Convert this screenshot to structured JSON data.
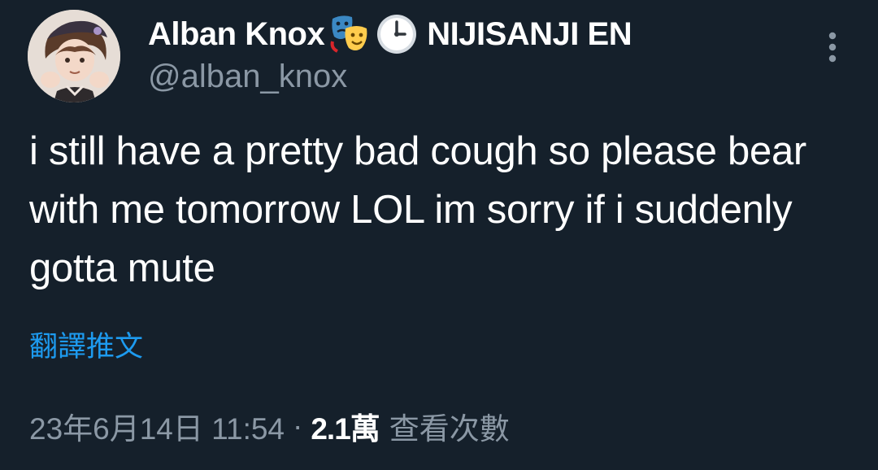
{
  "author": {
    "display_name": "Alban Knox",
    "name_suffix": "NIJISANJI EN",
    "handle": "@alban_knox",
    "emojis": [
      "performing-arts-icon",
      "one-oclock-icon"
    ]
  },
  "tweet": {
    "text": "i still have a pretty bad cough so please bear with me tomorrow LOL im sorry if i suddenly gotta mute",
    "translate_label": "翻譯推文"
  },
  "meta": {
    "timestamp": "23年6月14日 11:54",
    "separator": "·",
    "views_count": "2.1萬",
    "views_label": "查看次數"
  },
  "colors": {
    "background": "#15202b",
    "text_primary": "#ffffff",
    "text_secondary": "#8b98a5",
    "link": "#1d9bf0"
  },
  "icons": {
    "more_options": "more-vertical-icon",
    "avatar": "avatar"
  }
}
